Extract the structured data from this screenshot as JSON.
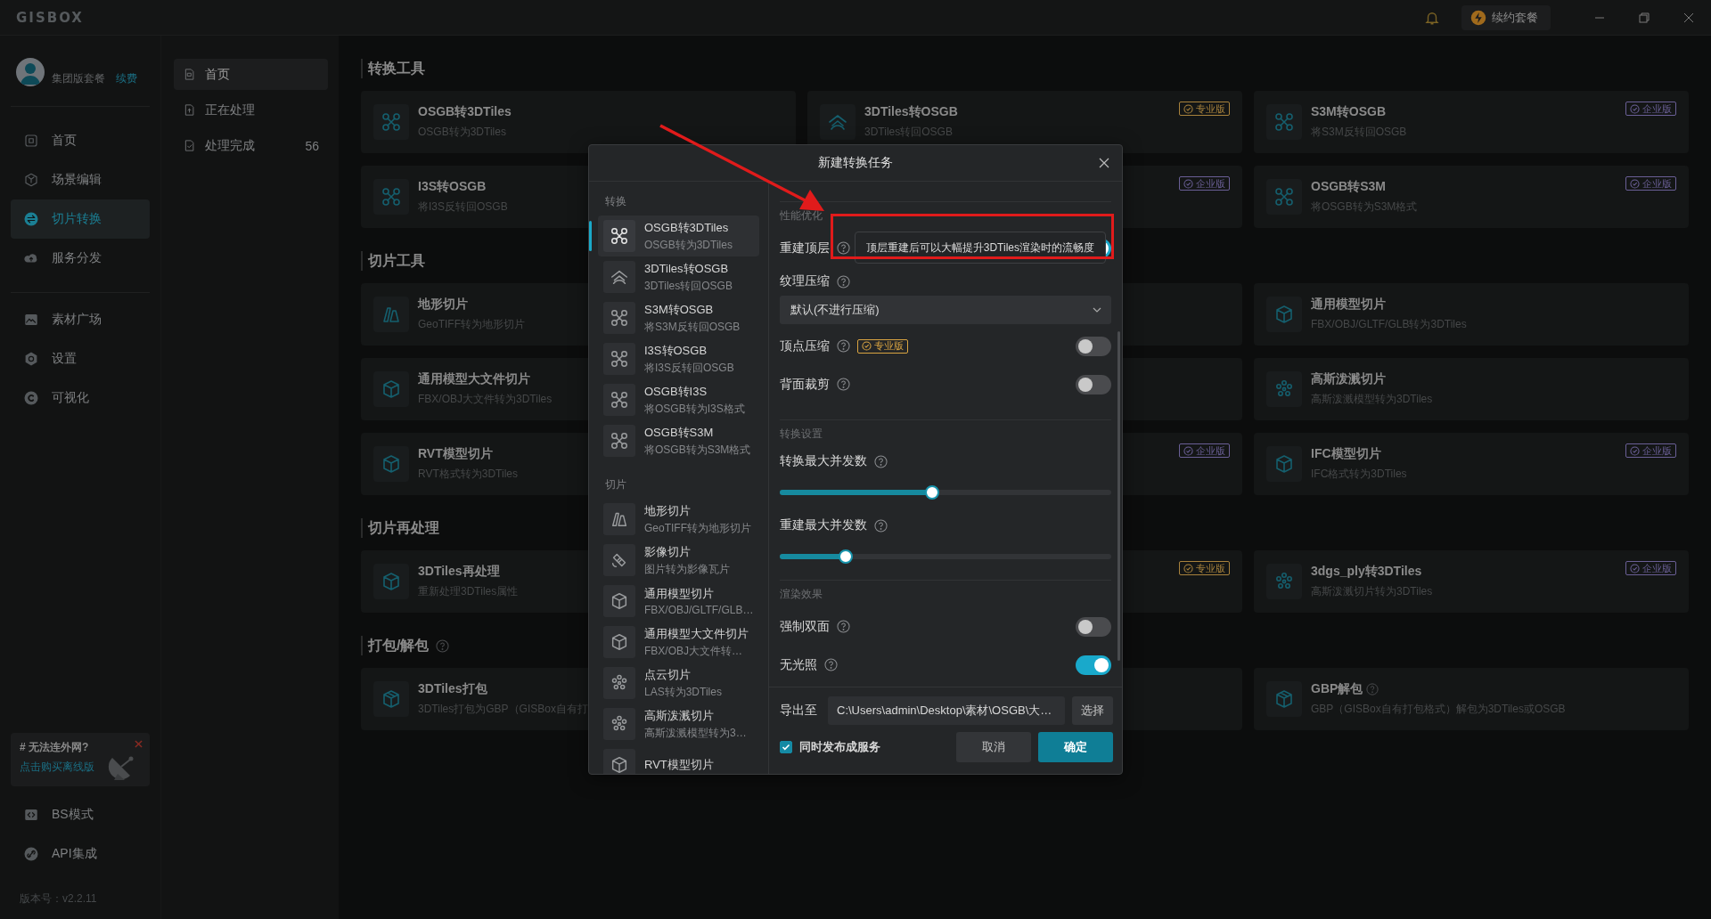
{
  "title_bar": {
    "logo": "GISBOX",
    "renew_button": "续约套餐"
  },
  "sidebar": {
    "plan": "集团版套餐",
    "renew_link": "续费",
    "nav_groups": [
      [
        {
          "label": "首页",
          "selected": false
        },
        {
          "label": "场景编辑",
          "selected": false
        },
        {
          "label": "切片转换",
          "selected": true
        },
        {
          "label": "服务分发",
          "selected": false
        }
      ],
      [
        {
          "label": "素材广场",
          "selected": false
        },
        {
          "label": "设置",
          "selected": false
        },
        {
          "label": "可视化",
          "selected": false
        }
      ]
    ],
    "promo": {
      "title": "# 无法连外网?",
      "link": "点击购买离线版"
    },
    "bottom_nav": [
      {
        "label": "BS模式"
      },
      {
        "label": "API集成"
      }
    ],
    "version": "版本号：v2.2.11"
  },
  "task_nav": [
    {
      "label": "首页",
      "selected": true
    },
    {
      "label": "正在处理",
      "selected": false
    },
    {
      "label": "处理完成",
      "selected": false,
      "count": "56"
    }
  ],
  "sections": [
    {
      "title": "转换工具",
      "cards": [
        {
          "kind": "tool",
          "title": "OSGB转3DTiles",
          "description": "OSGB转为3DTiles"
        },
        {
          "kind": "tool",
          "title": "3DTiles转OSGB",
          "description": "3DTiles转回OSGB",
          "badge": {
            "label": "专业版",
            "color": "#a8823c"
          }
        },
        {
          "kind": "tool",
          "title": "S3M转OSGB",
          "description": "将S3M反转回OSGB",
          "badge": {
            "label": "企业版",
            "color": "#6a5f96"
          }
        },
        {
          "kind": "tool",
          "title": "I3S转OSGB",
          "description": "将I3S反转回OSGB"
        },
        {
          "kind": "covered",
          "badge": {
            "label": "企业版",
            "color": "#6a5f96"
          }
        },
        {
          "kind": "tool",
          "title": "OSGB转S3M",
          "description": "将OSGB转为S3M格式",
          "badge": {
            "label": "企业版",
            "color": "#6a5f96"
          }
        }
      ]
    },
    {
      "title": "切片工具",
      "cards": [
        {
          "kind": "tool",
          "title": "地形切片",
          "description": "GeoTIFF转为地形切片"
        },
        {
          "kind": "covered"
        },
        {
          "kind": "tool",
          "title": "通用模型切片",
          "description": "FBX/OBJ/GLTF/GLB转为3DTiles"
        },
        {
          "kind": "tool",
          "title": "通用模型大文件切片",
          "description": "FBX/OBJ大文件转为3DTiles"
        },
        {
          "kind": "covered"
        },
        {
          "kind": "tool",
          "title": "高斯泼溅切片",
          "description": "高斯泼溅模型转为3DTiles"
        },
        {
          "kind": "tool",
          "title": "RVT模型切片",
          "description": "RVT格式转为3DTiles"
        },
        {
          "kind": "covered",
          "badge": {
            "label": "企业版",
            "color": "#6a5f96"
          }
        },
        {
          "kind": "tool",
          "title": "IFC模型切片",
          "description": "IFC格式转为3DTiles",
          "badge": {
            "label": "企业版",
            "color": "#6a5f96"
          }
        }
      ]
    },
    {
      "title": "切片再处理",
      "cards": [
        {
          "kind": "tool",
          "title": "3DTiles再处理",
          "description": "重新处理3DTiles属性"
        },
        {
          "kind": "covered",
          "badge": {
            "label": "专业版",
            "color": "#a8823c"
          }
        },
        {
          "kind": "tool",
          "title": "3dgs_ply转3DTiles",
          "description": "高斯泼溅切片转为3DTiles",
          "badge": {
            "label": "企业版",
            "color": "#6a5f96"
          }
        }
      ]
    },
    {
      "title": "打包/解包",
      "help": true,
      "cards": [
        {
          "kind": "tool",
          "title": "3DTiles打包",
          "description": "3DTiles打包为GBP（GISBox自有打"
        },
        {
          "kind": "covered"
        },
        {
          "kind": "tool",
          "title": "GBP解包",
          "help": true,
          "description": "GBP（GISBox自有打包格式）解包为3DTiles或OSGB"
        }
      ]
    }
  ],
  "dialog": {
    "title": "新建转换任务",
    "tool_groups": [
      {
        "label": "转换",
        "items": [
          {
            "title": "OSGB转3DTiles",
            "description": "OSGB转为3DTiles",
            "selected": true
          },
          {
            "title": "3DTiles转OSGB",
            "description": "3DTiles转回OSGB",
            "selected": false
          },
          {
            "title": "S3M转OSGB",
            "description": "将S3M反转回OSGB",
            "selected": false
          },
          {
            "title": "I3S转OSGB",
            "description": "将I3S反转回OSGB",
            "selected": false
          },
          {
            "title": "OSGB转I3S",
            "description": "将OSGB转为I3S格式",
            "selected": false
          },
          {
            "title": "OSGB转S3M",
            "description": "将OSGB转为S3M格式",
            "selected": false
          }
        ]
      },
      {
        "label": "切片",
        "items": [
          {
            "title": "地形切片",
            "description": "GeoTIFF转为地形切片",
            "selected": false
          },
          {
            "title": "影像切片",
            "description": "图片转为影像瓦片",
            "selected": false
          },
          {
            "title": "通用模型切片",
            "description": "FBX/OBJ/GLTF/GLB…",
            "selected": false
          },
          {
            "title": "通用模型大文件切片",
            "description": "FBX/OBJ大文件转…",
            "selected": false
          },
          {
            "title": "点云切片",
            "description": "LAS转为3DTiles",
            "selected": false
          },
          {
            "title": "高斯泼溅切片",
            "description": "高斯泼溅模型转为3…",
            "selected": false
          },
          {
            "title": "RVT模型切片",
            "selected": false
          }
        ]
      }
    ],
    "settings": [
      {
        "kind": "section",
        "label": "性能优化"
      },
      {
        "kind": "toggle",
        "label": "重建顶层",
        "help": true,
        "on": true,
        "tooltip": "顶层重建后可以大幅提升3DTiles渲染时的流畅度"
      },
      {
        "kind": "label",
        "label": "纹理压缩",
        "help": true
      },
      {
        "kind": "select",
        "value": "默认(不进行压缩)"
      },
      {
        "kind": "toggle",
        "label": "顶点压缩",
        "help": true,
        "on": false,
        "badge": {
          "label": "专业版",
          "color": "#d9a441"
        }
      },
      {
        "kind": "toggle",
        "label": "背面裁剪",
        "help": true,
        "on": false
      },
      {
        "kind": "section",
        "label": "转换设置"
      },
      {
        "kind": "slider",
        "label": "转换最大并发数",
        "help": true,
        "level": 0.46
      },
      {
        "kind": "slider",
        "label": "重建最大并发数",
        "help": true,
        "level": 0.2
      },
      {
        "kind": "section",
        "label": "渲染效果"
      },
      {
        "kind": "toggle",
        "label": "强制双面",
        "help": true,
        "on": false
      },
      {
        "kind": "toggle",
        "label": "无光照",
        "help": true,
        "on": true
      }
    ],
    "export": {
      "label": "导出至",
      "path": "C:\\Users\\admin\\Desktop\\素材\\OSGB\\大…",
      "button": "选择"
    },
    "publish": {
      "label": "同时发布成服务",
      "checked": true
    },
    "buttons": [
      {
        "label": "取消",
        "kind": "secondary"
      },
      {
        "label": "确定",
        "kind": "primary"
      }
    ]
  }
}
